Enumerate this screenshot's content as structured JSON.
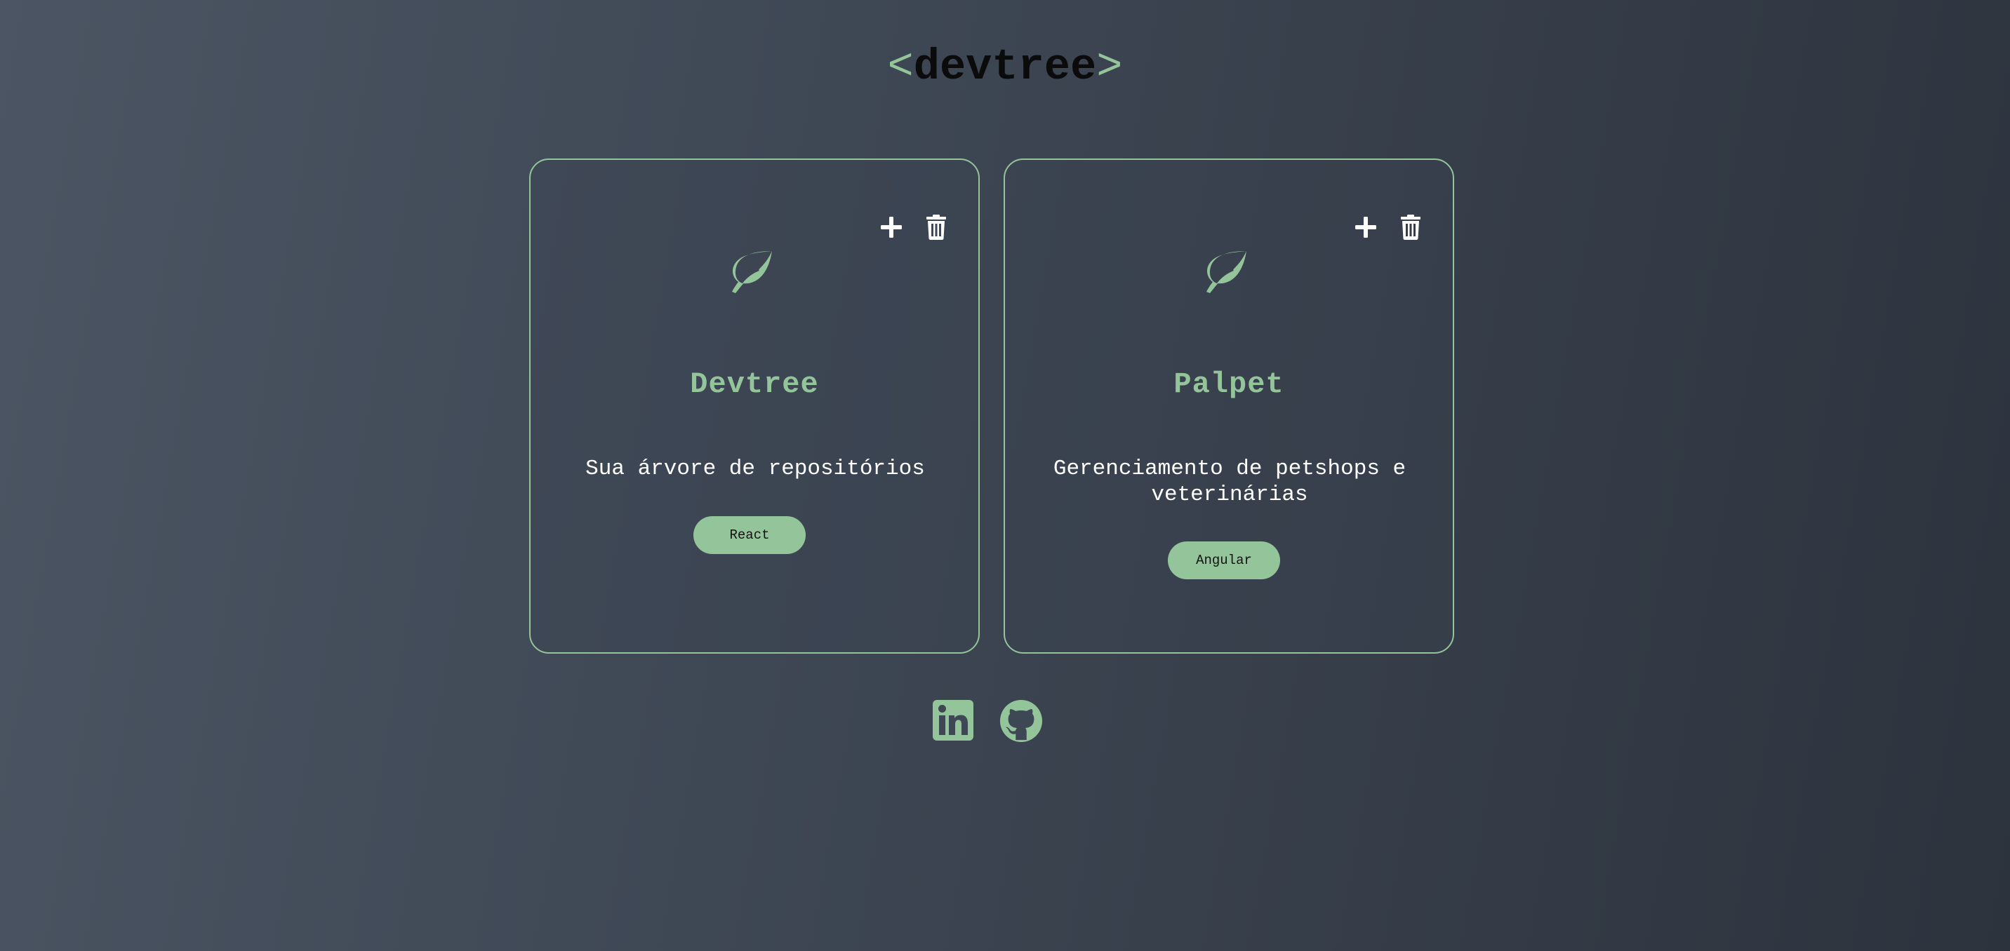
{
  "header": {
    "logo_open": "<",
    "logo_text": "devtree",
    "logo_close": ">"
  },
  "projects": [
    {
      "title": "Devtree",
      "description": "Sua árvore de repositórios",
      "tag": "React",
      "icon": "leaf-icon"
    },
    {
      "title": "Palpet",
      "description": "Gerenciamento de petshops e veterinárias",
      "tag": "Angular",
      "icon": "leaf-icon"
    }
  ],
  "actions": {
    "add_icon": "plus-icon",
    "delete_icon": "trash-icon"
  },
  "footer": {
    "links": [
      "linkedin-icon",
      "github-icon"
    ]
  },
  "colors": {
    "accent": "#94c59a",
    "background_start": "#4b5563",
    "background_end": "#2d333d",
    "text": "#ffffff",
    "logo": "#0b0b0b"
  }
}
